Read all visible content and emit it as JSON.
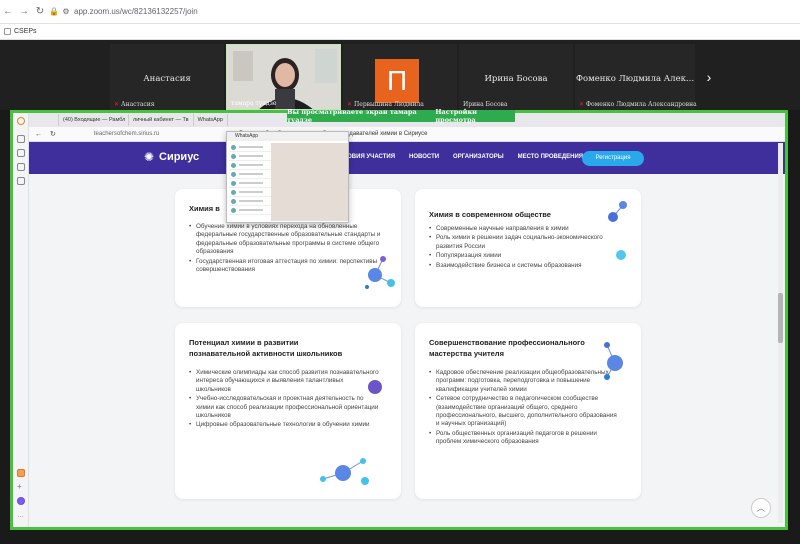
{
  "browser": {
    "url": "app.zoom.us/wc/82136132257/join",
    "bookmark_label": "CSEPs"
  },
  "participants": [
    {
      "name": "Анастасия",
      "label": "Анастасия"
    },
    {
      "name": "",
      "label": "тамара туадзе"
    },
    {
      "name": "",
      "label": "Первышина Людмила",
      "avatar_letter": "П",
      "avatar_color": "#e8641e"
    },
    {
      "name": "Ирина Босова",
      "label": "Ирина Босова"
    },
    {
      "name": "Фоменко Людмила Алек...",
      "label": "Фоменко Людмила Александровна"
    }
  ],
  "share_toolbar": {
    "notice": "Вы просматриваете экран тамара туадзе",
    "settings": "Настройки просмотра"
  },
  "inner_browser": {
    "tabs": [
      "(40) Входящие — Рамбл",
      "личный кабинет — Тв",
      "WhatsApp"
    ],
    "url": "teachersofchem.sirius.ru",
    "title": "Всероссийский съезд учителей и преподавателей химии в Сириусе"
  },
  "site": {
    "logo": "Сириус",
    "nav": [
      "УСЛОВИЯ УЧАСТИЯ",
      "НОВОСТИ",
      "ОРГАНИЗАТОРЫ",
      "МЕСТО ПРОВЕДЕНИЯ"
    ],
    "register": "Регистрация"
  },
  "whatsapp": {
    "title": "WhatsApp"
  },
  "cards": [
    {
      "title": "Химия в",
      "items": [
        "Обучение химии в условиях перехода на обновленные федеральные государственные образовательные стандарты и федеральные образовательные программы в системе общего образования",
        "Государственная итоговая аттестация по химии: перспективы совершенствования"
      ]
    },
    {
      "title": "Химия в современном обществе",
      "items": [
        "Современные научные направления в химии",
        "Роль химии в решении задач социально-экономического развития России",
        "Популяризация химии",
        "Взаимодействие бизнеса и системы образования"
      ]
    },
    {
      "title": "Потенциал химии в развитии познавательной активности школьников",
      "items": [
        "Химические олимпиады как способ развития познавательного интереса обучающихся и выявления талантливых школьников",
        "Учебно-исследовательская и проектная деятельность по химии как способ реализации профессиональной ориентации школьников",
        "Цифровые образовательные технологии в обучении химии"
      ]
    },
    {
      "title": "Совершенствование профессионального мастерства учителя",
      "items": [
        "Кадровое обеспечение реализации общеобразовательных программ: подготовка, переподготовка и повышение квалификации учителей химии",
        "Сетевое сотрудничество в педагогическом сообществе (взаимодействие организаций общего, среднего профессионального, высшего, дополнительного образования и научных организаций)",
        "Роль общественных организаций педагогов в решении проблем химического образования"
      ]
    }
  ]
}
